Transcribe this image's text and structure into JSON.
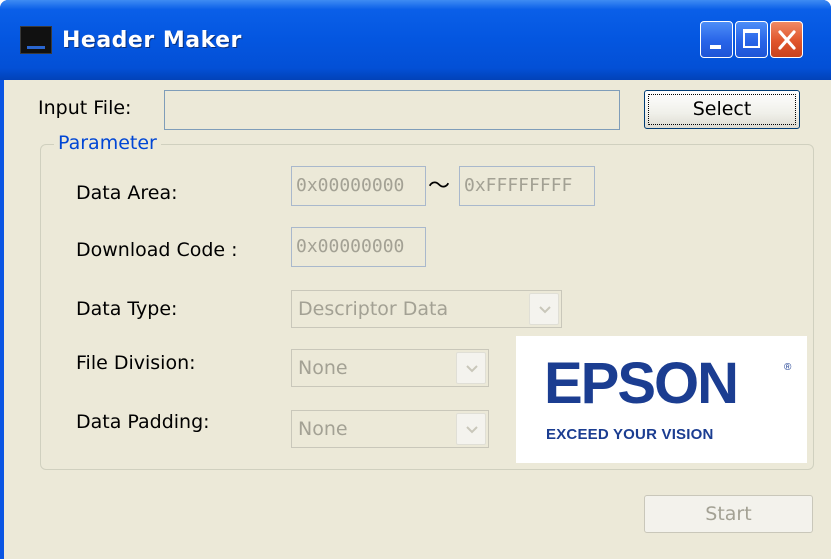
{
  "window": {
    "title": "Header Maker",
    "accent_color": "#0a55e3"
  },
  "controls": [
    "minimize-icon",
    "maximize-icon",
    "close-icon"
  ],
  "input_file": {
    "label": "Input File:",
    "value": "",
    "select_label": "Select"
  },
  "parameter": {
    "group_label": "Parameter",
    "data_area": {
      "label": "Data Area:",
      "start": "0x00000000",
      "separator": "〜",
      "end": "0xFFFFFFFF"
    },
    "download_code": {
      "label": "Download Code :",
      "value": "0x00000000"
    },
    "data_type": {
      "label": "Data Type:",
      "value": "Descriptor Data"
    },
    "file_division": {
      "label": "File Division:",
      "value": "None"
    },
    "data_padding": {
      "label": "Data Padding:",
      "value": "None"
    }
  },
  "logo": {
    "brand": "EPSON",
    "registered": "®",
    "tagline": "EXCEED YOUR VISION",
    "color": "#1b3d91"
  },
  "start_label": "Start"
}
